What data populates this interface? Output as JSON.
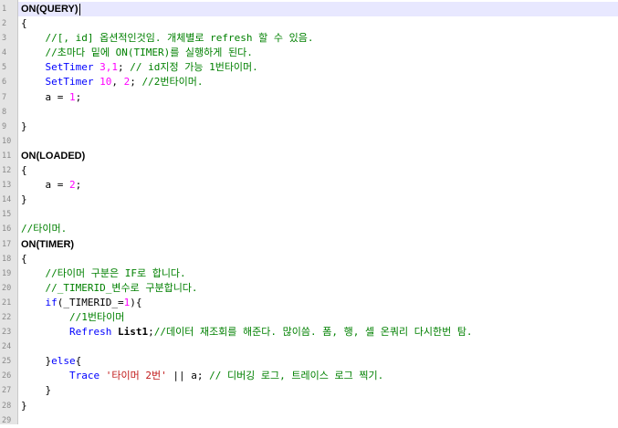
{
  "editor": {
    "line_numbers": [
      "1",
      "2",
      "3",
      "4",
      "5",
      "6",
      "7",
      "8",
      "9",
      "10",
      "11",
      "12",
      "13",
      "14",
      "15",
      "16",
      "17",
      "18",
      "19",
      "20",
      "21",
      "22",
      "23",
      "24",
      "25",
      "26",
      "27",
      "28",
      "29"
    ],
    "colors": {
      "gutter_bg": "#e4e4e4",
      "comment": "#008000",
      "function": "#0000ff",
      "number": "#ff00ff",
      "string": "#c01818",
      "current_line": "#e8e8ff"
    },
    "lines": {
      "l1_kw": "ON(QUERY)",
      "l2": "{",
      "l3_comment": "//[, id] 옵션적인것임. 개체별로 refresh 할 수 있음.",
      "l4_comment": "//초마다 밑에 ON(TIMER)를 실행하게 된다.",
      "l5_fn": "SetTimer",
      "l5_num": "3,1",
      "l5_sep": "; ",
      "l5_comment": "// id지정 가능 1번타이머.",
      "l6_fn": "SetTimer",
      "l6_num1": "10",
      "l6_sep1": ", ",
      "l6_num2": "2",
      "l6_sep2": "; ",
      "l6_comment": "//2번타이머.",
      "l7_var": "a = ",
      "l7_num": "1",
      "l7_end": ";",
      "l9": "}",
      "l11_kw": "ON(LOADED)",
      "l12": "{",
      "l13_var": "a = ",
      "l13_num": "2",
      "l13_end": ";",
      "l14": "}",
      "l16_comment": "//타이머.",
      "l17_kw": "ON(TIMER)",
      "l18": "{",
      "l19_comment": "//타이머 구분은 IF로 합니다.",
      "l20_comment": "//_TIMERID_변수로 구분합니다.",
      "l21_fn": "if",
      "l21_rest": "(_TIMERID_=",
      "l21_num": "1",
      "l21_end": "){",
      "l22_comment": "//1번타이머",
      "l23_fn": "Refresh",
      "l23_obj": "List1",
      "l23_sep": ";",
      "l23_comment": "//데이터 재조회를 해준다. 많이씀. 폼, 행, 셀 온쿼리 다시한번 탐.",
      "l25_rest": "}",
      "l25_fn": "else",
      "l25_end": "{",
      "l26_fn": "Trace",
      "l26_str": "'타이머 2번'",
      "l26_mid": " || a; ",
      "l26_comment": "// 디버깅 로그, 트레이스 로그 찍기.",
      "l27": "}",
      "l28": "}"
    }
  }
}
